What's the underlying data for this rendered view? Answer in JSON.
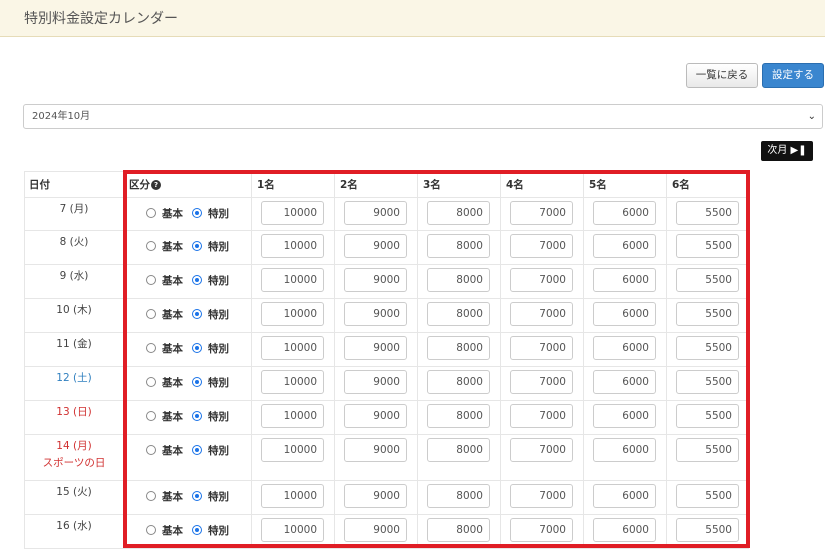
{
  "header": {
    "title": "特別料金設定カレンダー"
  },
  "toolbar": {
    "back_label": "一覧に戻る",
    "save_label": "設定する"
  },
  "month_select": {
    "value": "2024年10月"
  },
  "next_button": {
    "label": "次月"
  },
  "table": {
    "headers": {
      "date": "日付",
      "category": "区分",
      "p1": "1名",
      "p2": "2名",
      "p3": "3名",
      "p4": "4名",
      "p5": "5名",
      "p6": "6名"
    },
    "radio_labels": {
      "basic": "基本",
      "special": "特別"
    },
    "rows": [
      {
        "date": "7 (月)",
        "day_type": "weekday",
        "holiday": "",
        "selected": "special",
        "prices": [
          "10000",
          "9000",
          "8000",
          "7000",
          "6000",
          "5500"
        ]
      },
      {
        "date": "8 (火)",
        "day_type": "weekday",
        "holiday": "",
        "selected": "special",
        "prices": [
          "10000",
          "9000",
          "8000",
          "7000",
          "6000",
          "5500"
        ]
      },
      {
        "date": "9 (水)",
        "day_type": "weekday",
        "holiday": "",
        "selected": "special",
        "prices": [
          "10000",
          "9000",
          "8000",
          "7000",
          "6000",
          "5500"
        ]
      },
      {
        "date": "10 (木)",
        "day_type": "weekday",
        "holiday": "",
        "selected": "special",
        "prices": [
          "10000",
          "9000",
          "8000",
          "7000",
          "6000",
          "5500"
        ]
      },
      {
        "date": "11 (金)",
        "day_type": "weekday",
        "holiday": "",
        "selected": "special",
        "prices": [
          "10000",
          "9000",
          "8000",
          "7000",
          "6000",
          "5500"
        ]
      },
      {
        "date": "12 (土)",
        "day_type": "saturday",
        "holiday": "",
        "selected": "special",
        "prices": [
          "10000",
          "9000",
          "8000",
          "7000",
          "6000",
          "5500"
        ]
      },
      {
        "date": "13 (日)",
        "day_type": "sunday",
        "holiday": "",
        "selected": "special",
        "prices": [
          "10000",
          "9000",
          "8000",
          "7000",
          "6000",
          "5500"
        ]
      },
      {
        "date": "14 (月)",
        "day_type": "holiday",
        "holiday": "スポーツの日",
        "selected": "special",
        "prices": [
          "10000",
          "9000",
          "8000",
          "7000",
          "6000",
          "5500"
        ]
      },
      {
        "date": "15 (火)",
        "day_type": "weekday",
        "holiday": "",
        "selected": "special",
        "prices": [
          "10000",
          "9000",
          "8000",
          "7000",
          "6000",
          "5500"
        ]
      },
      {
        "date": "16 (水)",
        "day_type": "weekday",
        "holiday": "",
        "selected": "special",
        "prices": [
          "10000",
          "9000",
          "8000",
          "7000",
          "6000",
          "5500"
        ]
      }
    ]
  },
  "colors": {
    "saturday": "#2f7fbf",
    "sunday": "#d03030",
    "highlight_border": "#e01d25",
    "primary_button": "#3a86cf"
  }
}
